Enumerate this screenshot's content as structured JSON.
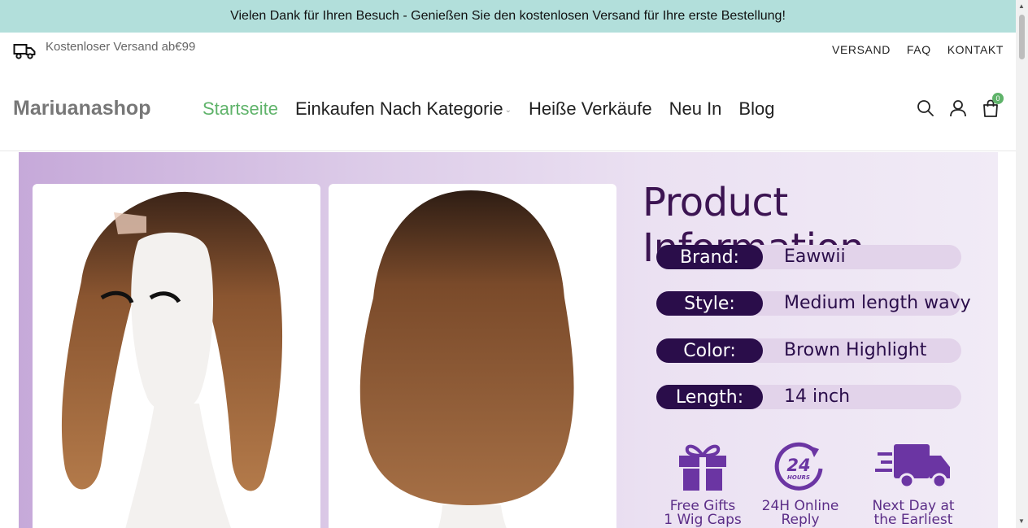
{
  "announcement": "Vielen Dank für Ihren Besuch - Genießen Sie den kostenlosen Versand für Ihre erste Bestellung!",
  "topbar": {
    "shipping_text": "Kostenloser Versand ab€99",
    "links": [
      "VERSAND",
      "FAQ",
      "KONTAKT"
    ]
  },
  "header": {
    "logo": "Mariuanashop",
    "nav": [
      "Startseite",
      "Einkaufen Nach Kategorie",
      "Heiße Verkäufe",
      "Neu In",
      "Blog"
    ],
    "cart_count": "0"
  },
  "banner": {
    "title": "Product Information",
    "specs": [
      {
        "label": "Brand:",
        "value": "Eawwii"
      },
      {
        "label": "Style:",
        "value": "Medium length wavy"
      },
      {
        "label": "Color:",
        "value": "Brown Highlight"
      },
      {
        "label": "Length:",
        "value": "14 inch"
      }
    ],
    "features": [
      {
        "icon": "gift-icon",
        "line1": "Free Gifts",
        "line2": "1 Wig Caps"
      },
      {
        "icon": "24-hours-icon",
        "line1": "24H Online",
        "line2": "Reply",
        "badge_text": "24",
        "badge_sub": "HOURS"
      },
      {
        "icon": "delivery-truck-icon",
        "line1": "Next Day at",
        "line2": "the Earliest"
      }
    ]
  },
  "colors": {
    "announcement_bg": "#b2dfdb",
    "active_nav": "#5fb36a",
    "banner_dark": "#2a0d4a",
    "banner_accent": "#5b2d87"
  }
}
